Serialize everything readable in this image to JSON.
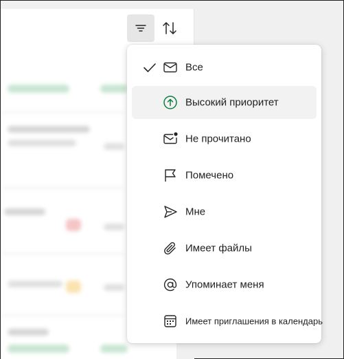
{
  "toolbar": {
    "filter_icon": "filter-icon",
    "sort_icon": "sort-arrows-icon"
  },
  "filter_menu": {
    "items": [
      {
        "label": "Все",
        "icon": "mail-icon",
        "checked": true
      },
      {
        "label": "Высокий приоритет",
        "icon": "arrow-up-circle-icon",
        "checked": false
      },
      {
        "label": "Не прочитано",
        "icon": "mail-unread-icon",
        "checked": false
      },
      {
        "label": "Помечено",
        "icon": "flag-icon",
        "checked": false
      },
      {
        "label": "Мне",
        "icon": "send-icon",
        "checked": false
      },
      {
        "label": "Имеет файлы",
        "icon": "paperclip-icon",
        "checked": false
      },
      {
        "label": "Упоминает меня",
        "icon": "at-sign-icon",
        "checked": false
      },
      {
        "label": "Имеет приглашения в календарь",
        "icon": "calendar-icon",
        "checked": false
      }
    ]
  },
  "colors": {
    "accent_green": "#107c41",
    "hover_bg": "#f2f2f2",
    "text": "#1f1f1f"
  }
}
